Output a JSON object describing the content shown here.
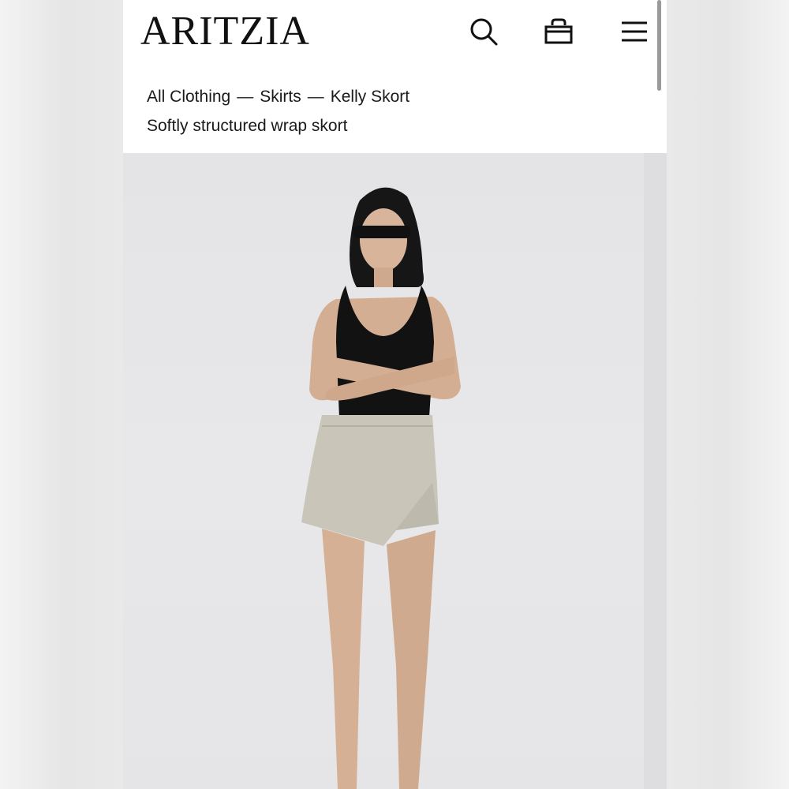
{
  "header": {
    "brand": "ARITZIA",
    "icons": [
      "search-icon",
      "bag-icon",
      "menu-icon"
    ]
  },
  "breadcrumb": {
    "items": [
      "All Clothing",
      "Skirts",
      "Kelly Skort"
    ],
    "separator": "—"
  },
  "product": {
    "subtitle": "Softly structured wrap skort"
  },
  "colors": {
    "text": "#111111",
    "photo_bg": "#e6e6e8",
    "skort": "#c9c5b9",
    "tank": "#121212"
  }
}
